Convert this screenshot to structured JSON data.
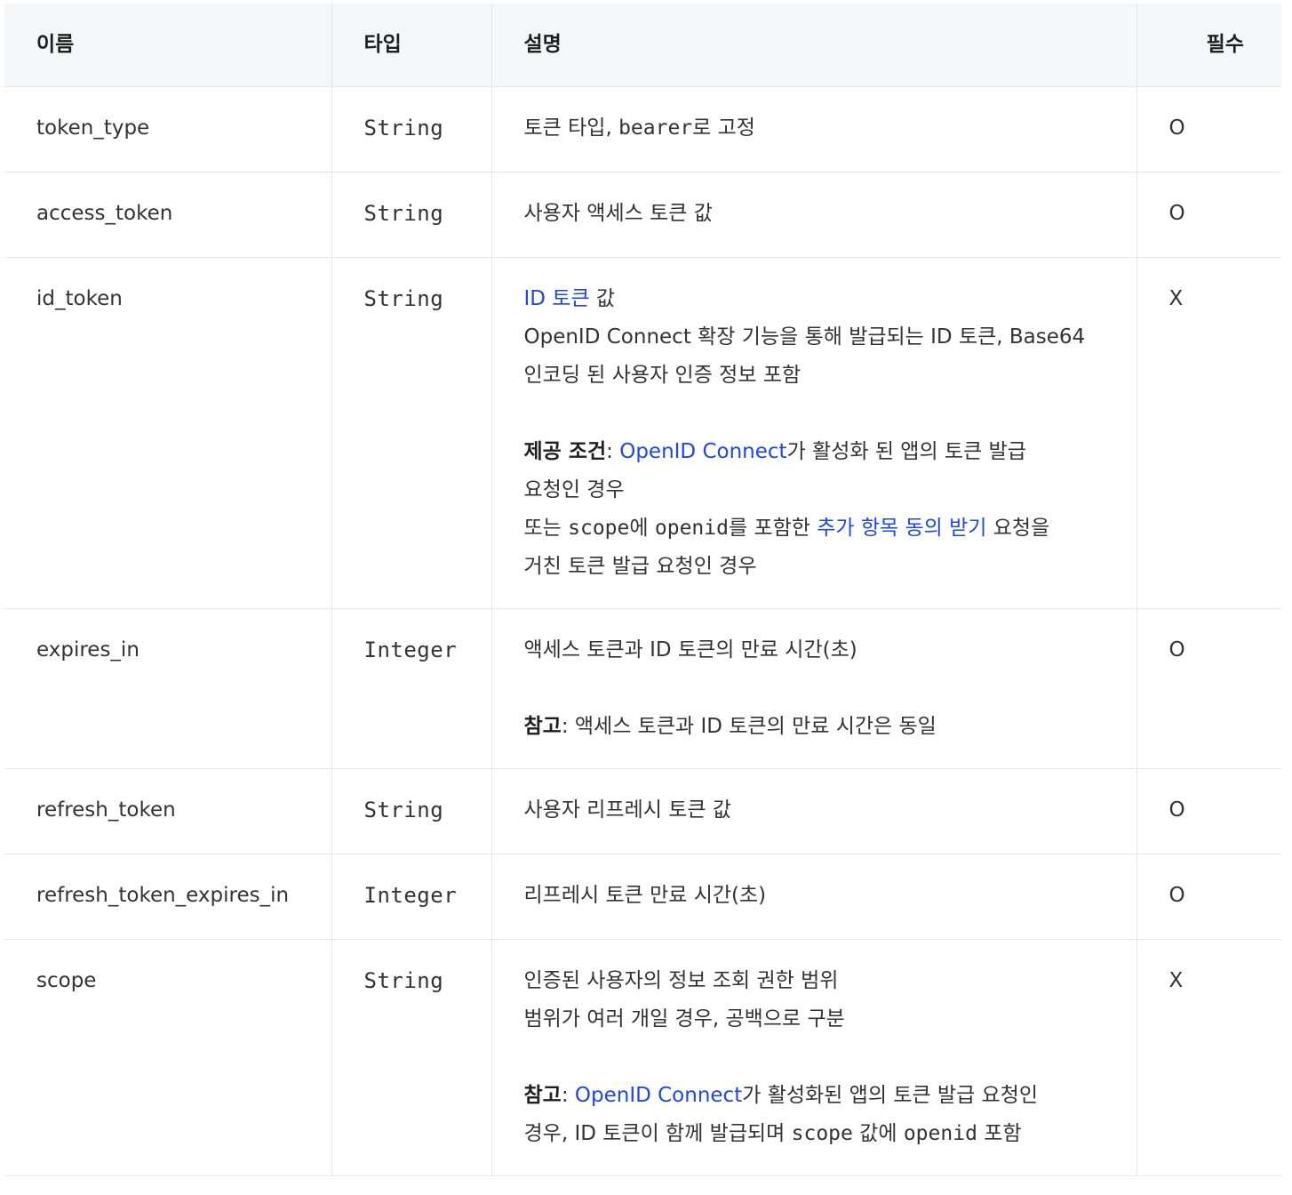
{
  "headers": {
    "name": "이름",
    "type": "타입",
    "description": "설명",
    "required": "필수"
  },
  "rows": [
    {
      "name": "token_type",
      "type": "String",
      "desc": {
        "p1": "토큰 타입, ",
        "code1": "bearer",
        "p2": "로 고정"
      },
      "required": "O"
    },
    {
      "name": "access_token",
      "type": "String",
      "desc": {
        "text": "사용자 액세스 토큰 값"
      },
      "required": "O"
    },
    {
      "name": "id_token",
      "type": "String",
      "desc": {
        "link1": "ID 토큰",
        "t1": " 값",
        "line2": "OpenID Connect 확장 기능을 통해 발급되는 ID 토큰, Base64",
        "line3": "인코딩 된 사용자 인증 정보 포함",
        "cond_label": "제공 조건",
        "cond_colon": ": ",
        "cond_link": "OpenID Connect",
        "cond_t1": "가 활성화 된 앱의 토큰 발급",
        "cond_line2": "요청인 경우",
        "or_t1": "또는 ",
        "or_code1": "scope",
        "or_t2": "에 ",
        "or_code2": "openid",
        "or_t3": "를 포함한 ",
        "or_link": "추가 항목 동의 받기",
        "or_t4": " 요청을",
        "or_line2": "거친 토큰 발급 요청인 경우"
      },
      "required": "X"
    },
    {
      "name": "expires_in",
      "type": "Integer",
      "desc": {
        "line1": "액세스 토큰과 ID 토큰의 만료 시간(초)",
        "note_label": "참고",
        "note_text": ": 액세스 토큰과 ID 토큰의 만료 시간은 동일"
      },
      "required": "O"
    },
    {
      "name": "refresh_token",
      "type": "String",
      "desc": {
        "text": "사용자 리프레시 토큰 값"
      },
      "required": "O"
    },
    {
      "name": "refresh_token_expires_in",
      "type": "Integer",
      "desc": {
        "text": "리프레시 토큰 만료 시간(초)"
      },
      "required": "O"
    },
    {
      "name": "scope",
      "type": "String",
      "desc": {
        "line1": "인증된 사용자의 정보 조회 권한 범위",
        "line2": "범위가 여러 개일 경우, 공백으로 구분",
        "note_label": "참고",
        "note_colon": ": ",
        "note_link": "OpenID Connect",
        "note_t1": "가 활성화된 앱의 토큰 발급 요청인",
        "note_t2": "경우, ID 토큰이 함께 발급되며 ",
        "note_code1": "scope",
        "note_t3": " 값에 ",
        "note_code2": "openid",
        "note_t4": " 포함"
      },
      "required": "X"
    }
  ]
}
